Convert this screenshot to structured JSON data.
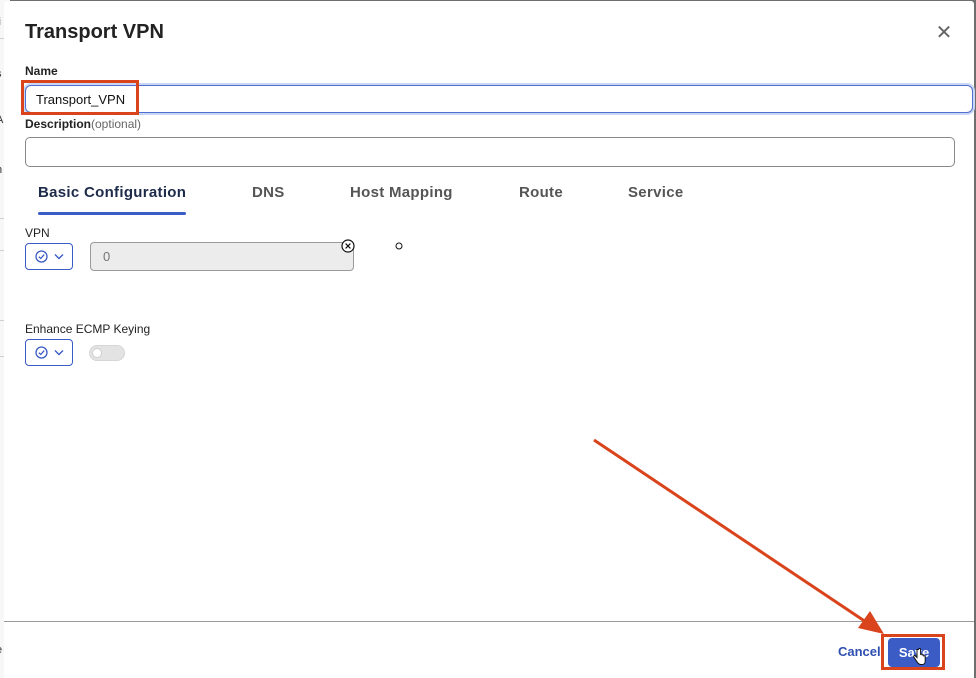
{
  "modal": {
    "title": "Transport VPN",
    "close_icon": "close-icon",
    "name_label": "Name",
    "name_value": "Transport_VPN",
    "description_label": "Description",
    "description_optional": "(optional)",
    "description_value": ""
  },
  "tabs": [
    {
      "label": "Basic Configuration",
      "active": true
    },
    {
      "label": "DNS",
      "active": false
    },
    {
      "label": "Host Mapping",
      "active": false
    },
    {
      "label": "Route",
      "active": false
    },
    {
      "label": "Service",
      "active": false
    }
  ],
  "vpn": {
    "label": "VPN",
    "scope_icon": "check-circle-icon",
    "value": "0"
  },
  "ecmp": {
    "label": "Enhance ECMP Keying",
    "scope_icon": "check-circle-icon",
    "toggle_on": false
  },
  "footer": {
    "cancel_label": "Cancel",
    "save_label": "Save"
  },
  "background_fragments": [
    "li",
    "s",
    "A",
    "[",
    "h",
    "e"
  ],
  "colors": {
    "accent": "#3b5bc5",
    "annotation": "#d9441c"
  }
}
